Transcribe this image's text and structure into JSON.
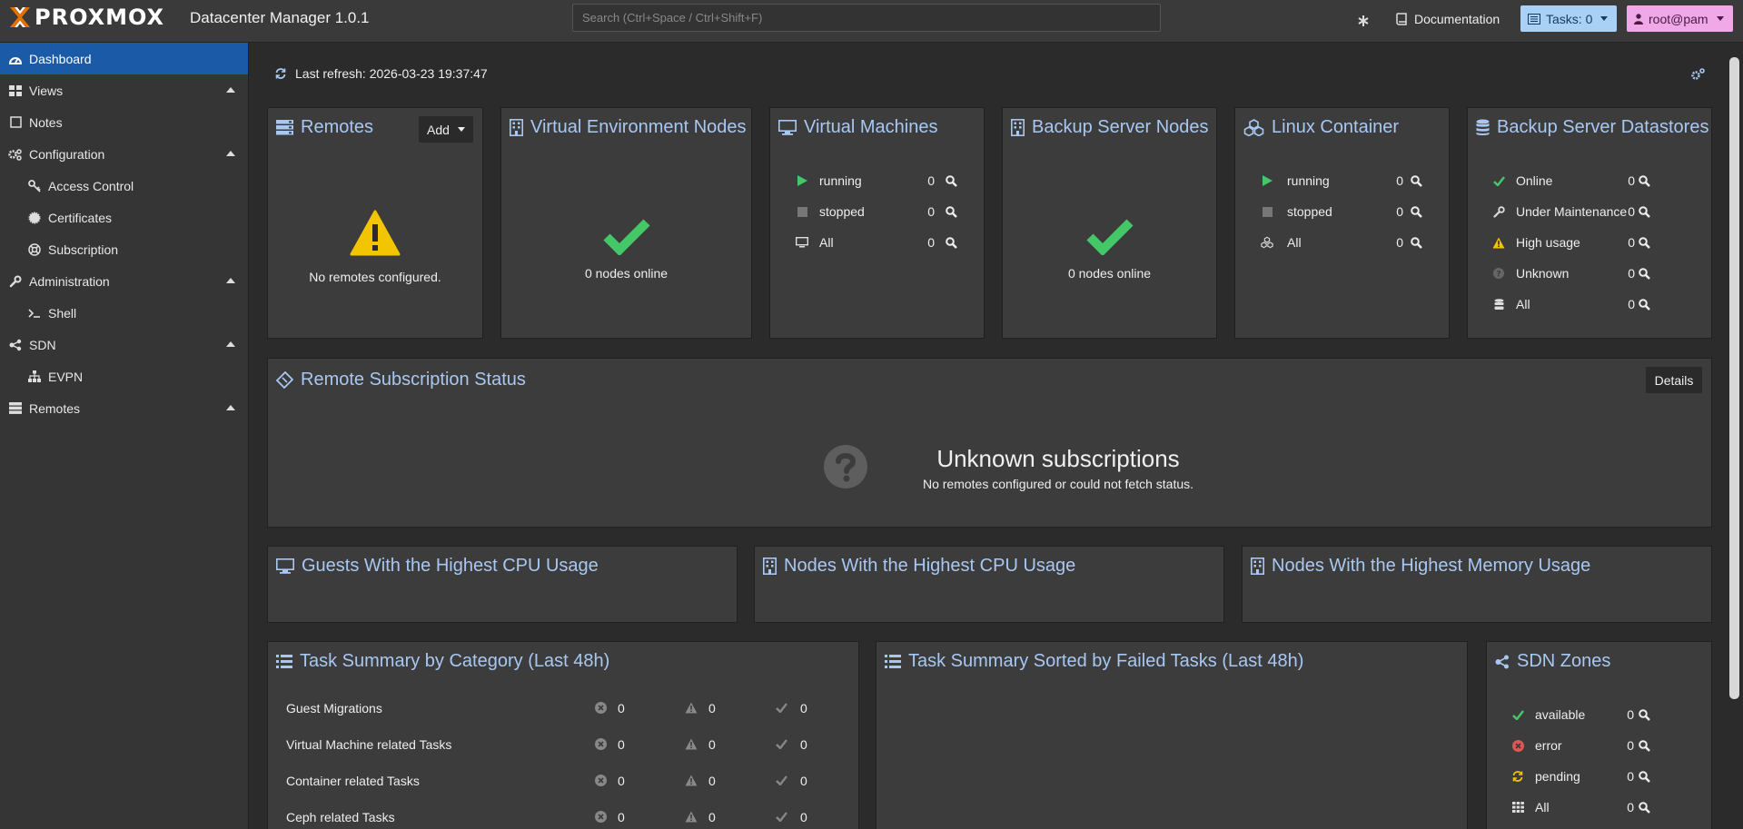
{
  "topbar": {
    "brand": "PROXMOX",
    "app_title": "Datacenter Manager 1.0.1",
    "search_placeholder": "Search (Ctrl+Space / Ctrl+Shift+F)",
    "documentation": "Documentation",
    "tasks": "Tasks: 0",
    "user": "root@pam"
  },
  "sidebar": {
    "items": [
      {
        "label": "Dashboard",
        "icon": "dashboard-icon"
      },
      {
        "label": "Views",
        "icon": "views-grid-icon"
      },
      {
        "label": "Notes",
        "icon": "notes-icon"
      },
      {
        "label": "Configuration",
        "icon": "cogs-icon"
      },
      {
        "label": "Access Control",
        "icon": "key-icon"
      },
      {
        "label": "Certificates",
        "icon": "certificate-icon"
      },
      {
        "label": "Subscription",
        "icon": "support-icon"
      },
      {
        "label": "Administration",
        "icon": "wrench-icon"
      },
      {
        "label": "Shell",
        "icon": "terminal-icon"
      },
      {
        "label": "SDN",
        "icon": "sdn-icon"
      },
      {
        "label": "EVPN",
        "icon": "sitemap-icon"
      },
      {
        "label": "Remotes",
        "icon": "server-icon"
      }
    ]
  },
  "dashboard": {
    "last_refresh": "Last refresh: 2026-03-23 19:37:47",
    "remotes": {
      "title": "Remotes",
      "add_label": "Add",
      "empty_text": "No remotes configured."
    },
    "ve_nodes": {
      "title": "Virtual Environment Nodes",
      "status_text": "0 nodes online"
    },
    "vms": {
      "title": "Virtual Machines",
      "rows": [
        {
          "label": "running",
          "value": "0"
        },
        {
          "label": "stopped",
          "value": "0"
        },
        {
          "label": "All",
          "value": "0"
        }
      ]
    },
    "backup_nodes": {
      "title": "Backup Server Nodes",
      "status_text": "0 nodes online"
    },
    "containers": {
      "title": "Linux Container",
      "rows": [
        {
          "label": "running",
          "value": "0"
        },
        {
          "label": "stopped",
          "value": "0"
        },
        {
          "label": "All",
          "value": "0"
        }
      ]
    },
    "datastores": {
      "title": "Backup Server Datastores",
      "rows": [
        {
          "label": "Online",
          "value": "0"
        },
        {
          "label": "Under Maintenance",
          "value": "0"
        },
        {
          "label": "High usage",
          "value": "0"
        },
        {
          "label": "Unknown",
          "value": "0"
        },
        {
          "label": "All",
          "value": "0"
        }
      ]
    },
    "subscription": {
      "title": "Remote Subscription Status",
      "details_label": "Details",
      "heading": "Unknown subscriptions",
      "subtext": "No remotes configured or could not fetch status."
    },
    "guests_cpu": {
      "title": "Guests With the Highest CPU Usage"
    },
    "nodes_cpu": {
      "title": "Nodes With the Highest CPU Usage"
    },
    "nodes_mem": {
      "title": "Nodes With the Highest Memory Usage"
    },
    "task_summary": {
      "title": "Task Summary by Category (Last 48h)",
      "rows": [
        {
          "label": "Guest Migrations",
          "error": "0",
          "warning": "0",
          "ok": "0"
        },
        {
          "label": "Virtual Machine related Tasks",
          "error": "0",
          "warning": "0",
          "ok": "0"
        },
        {
          "label": "Container related Tasks",
          "error": "0",
          "warning": "0",
          "ok": "0"
        },
        {
          "label": "Ceph related Tasks",
          "error": "0",
          "warning": "0",
          "ok": "0"
        }
      ]
    },
    "task_failed": {
      "title": "Task Summary Sorted by Failed Tasks (Last 48h)"
    },
    "sdn_zones": {
      "title": "SDN Zones",
      "rows": [
        {
          "label": "available",
          "value": "0"
        },
        {
          "label": "error",
          "value": "0"
        },
        {
          "label": "pending",
          "value": "0"
        },
        {
          "label": "All",
          "value": "0"
        }
      ]
    }
  },
  "colors": {
    "accent_blue": "#a8c8f2",
    "active_nav": "#1b5aa6",
    "ok_green": "#44c767",
    "warn_yellow": "#f2c500",
    "error_red": "#e05555",
    "tasks_button": "#a9d1f5",
    "user_button": "#f0a8e8",
    "proxmox_orange": "#e57000"
  }
}
